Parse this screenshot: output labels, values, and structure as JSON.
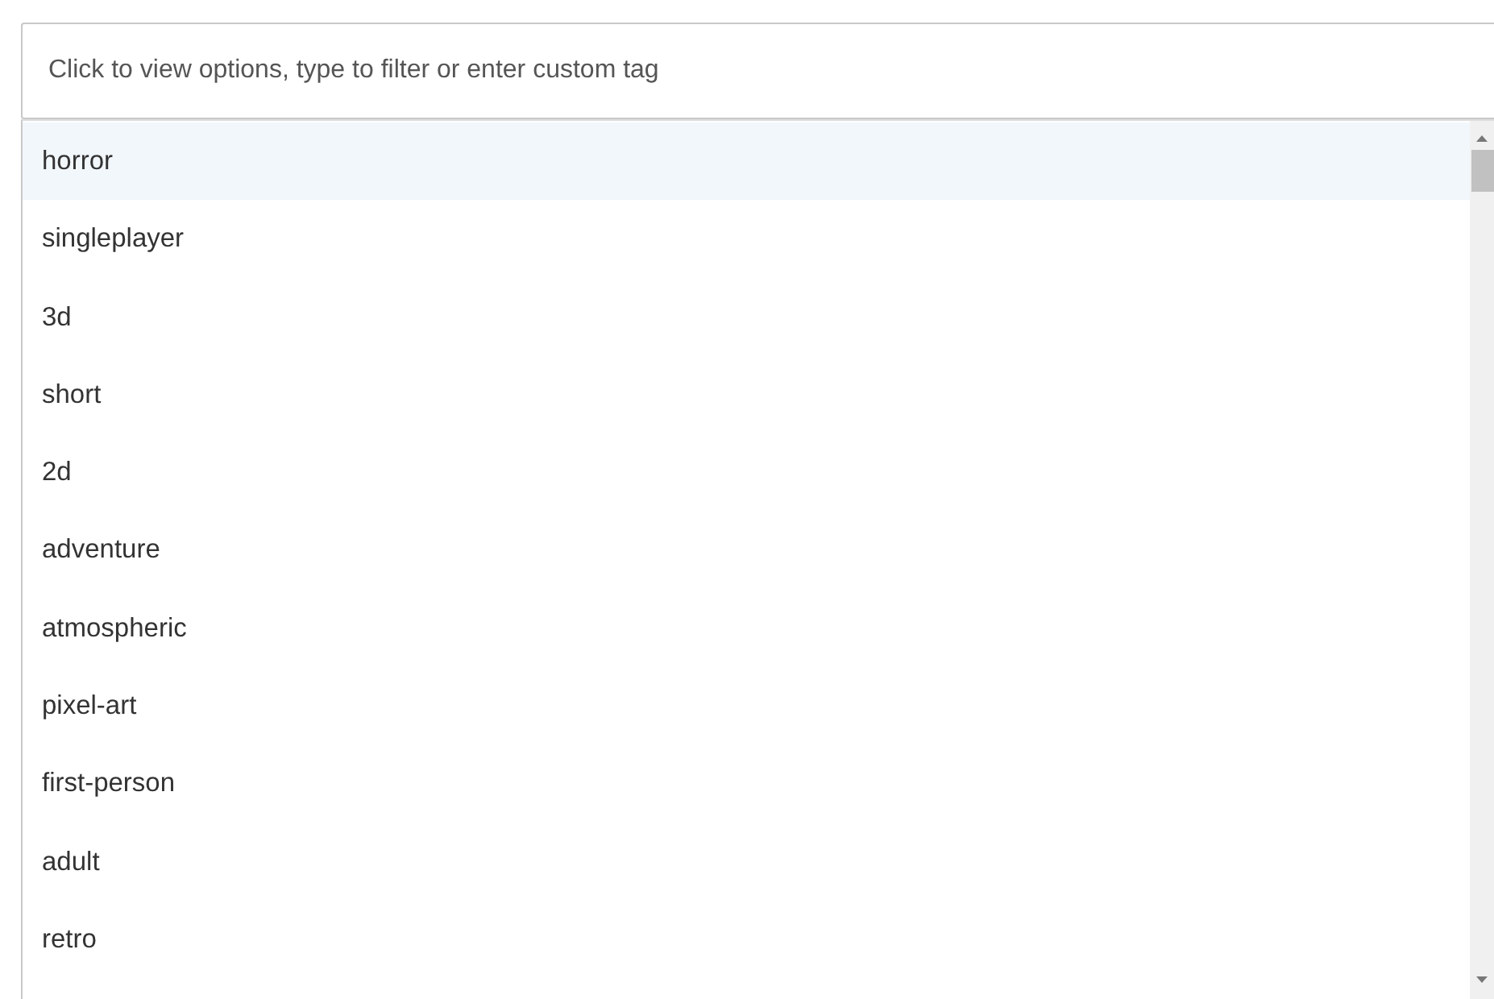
{
  "tag_field": {
    "placeholder": "Click to view options, type to filter or enter custom tag"
  },
  "options": [
    {
      "label": "horror",
      "selected": true
    },
    {
      "label": "singleplayer",
      "selected": false
    },
    {
      "label": "3d",
      "selected": false
    },
    {
      "label": "short",
      "selected": false
    },
    {
      "label": "2d",
      "selected": false
    },
    {
      "label": "adventure",
      "selected": false
    },
    {
      "label": "atmospheric",
      "selected": false
    },
    {
      "label": "pixel-art",
      "selected": false
    },
    {
      "label": "first-person",
      "selected": false
    },
    {
      "label": "adult",
      "selected": false
    },
    {
      "label": "retro",
      "selected": false
    }
  ]
}
